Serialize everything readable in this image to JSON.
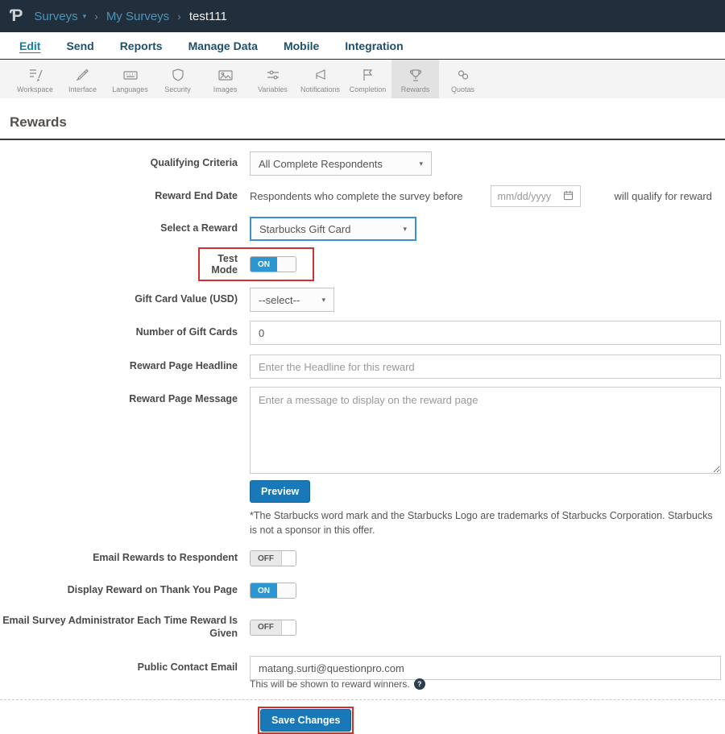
{
  "colors": {
    "topbar_bg": "#212f3c",
    "accent_blue": "#1878b8",
    "toggle_on_blue": "#2b96d1",
    "highlight_red": "#d32f2f"
  },
  "topbar": {
    "logo_text": "Ƥ",
    "breadcrumb": {
      "surveys": "Surveys",
      "my_surveys": "My Surveys",
      "current": "test111"
    }
  },
  "menu": {
    "items": [
      {
        "label": "Edit"
      },
      {
        "label": "Send"
      },
      {
        "label": "Reports"
      },
      {
        "label": "Manage Data"
      },
      {
        "label": "Mobile"
      },
      {
        "label": "Integration"
      }
    ]
  },
  "toolbar": {
    "items": [
      {
        "label": "Workspace"
      },
      {
        "label": "Interface"
      },
      {
        "label": "Languages"
      },
      {
        "label": "Security"
      },
      {
        "label": "Images"
      },
      {
        "label": "Variables"
      },
      {
        "label": "Notifications"
      },
      {
        "label": "Completion"
      },
      {
        "label": "Rewards"
      },
      {
        "label": "Quotas"
      }
    ]
  },
  "page": {
    "title": "Rewards"
  },
  "form": {
    "qualifying_criteria": {
      "label": "Qualifying Criteria",
      "value": "All Complete Respondents"
    },
    "reward_end_date": {
      "label": "Reward End Date",
      "before_text": "Respondents who complete the survey before",
      "placeholder": "mm/dd/yyyy",
      "after_text": "will qualify for reward"
    },
    "select_reward": {
      "label": "Select a Reward",
      "value": "Starbucks Gift Card"
    },
    "test_mode": {
      "label": "Test Mode",
      "state": "ON"
    },
    "gift_card_value": {
      "label": "Gift Card Value (USD)",
      "value": "--select--"
    },
    "num_gift_cards": {
      "label": "Number of Gift Cards",
      "value": "0"
    },
    "headline": {
      "label": "Reward Page Headline",
      "placeholder": "Enter the Headline for this reward"
    },
    "message": {
      "label": "Reward Page Message",
      "placeholder": "Enter a message to display on the reward page"
    },
    "preview_button": "Preview",
    "disclaimer": "*The Starbucks word mark and the Starbucks Logo are trademarks of Starbucks Corporation. Starbucks is not a sponsor in this offer.",
    "email_rewards": {
      "label": "Email Rewards to Respondent",
      "state": "OFF"
    },
    "display_reward": {
      "label": "Display Reward on Thank You Page",
      "state": "ON"
    },
    "email_admin": {
      "label": "Email Survey Administrator Each Time Reward Is Given",
      "state": "OFF"
    },
    "public_email": {
      "label": "Public Contact Email",
      "value": "matang.surti@questionpro.com",
      "helper": "This will be shown to reward winners."
    },
    "save_button": "Save Changes"
  }
}
